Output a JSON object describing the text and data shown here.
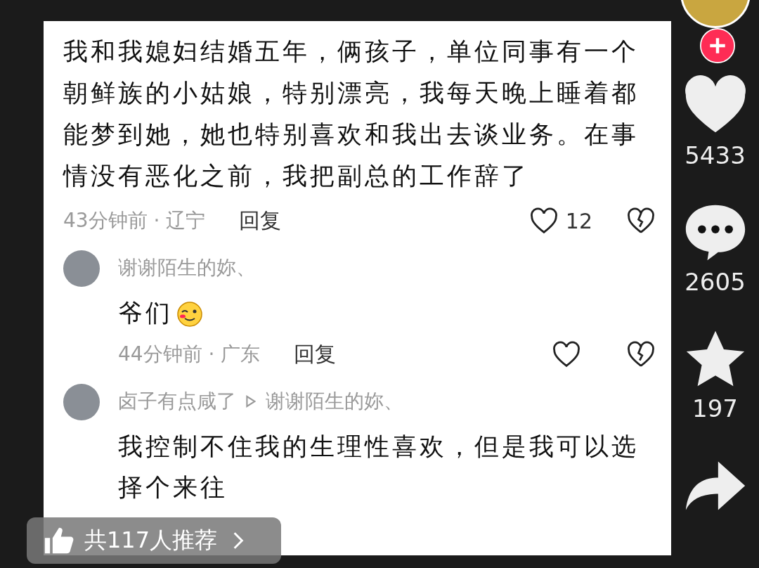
{
  "comment": {
    "text": "我和我媳妇结婚五年，俩孩子，单位同事有一个朝鲜族的小姑娘，特别漂亮，我每天晚上睡着都能梦到她，她也特别喜欢和我出去谈业务。在事情没有恶化之前，我把副总的工作辞了",
    "time": "43分钟前 · 辽宁",
    "reply_label": "回复",
    "likes": "12"
  },
  "replies": [
    {
      "author": "谢谢陌生的妳、",
      "text": "爷们",
      "emoji": true,
      "time": "44分钟前 · 广东",
      "reply_label": "回复"
    },
    {
      "author": "卤子有点咸了",
      "reply_to": "谢谢陌生的妳、",
      "text": "我控制不住我的生理性喜欢，但是我可以选择个来往"
    }
  ],
  "recommend": {
    "label": "共117人推荐"
  },
  "rail": [
    {
      "kind": "like",
      "count": "5433"
    },
    {
      "kind": "comment",
      "count": "2605"
    },
    {
      "kind": "favorite",
      "count": "197"
    },
    {
      "kind": "share"
    }
  ]
}
